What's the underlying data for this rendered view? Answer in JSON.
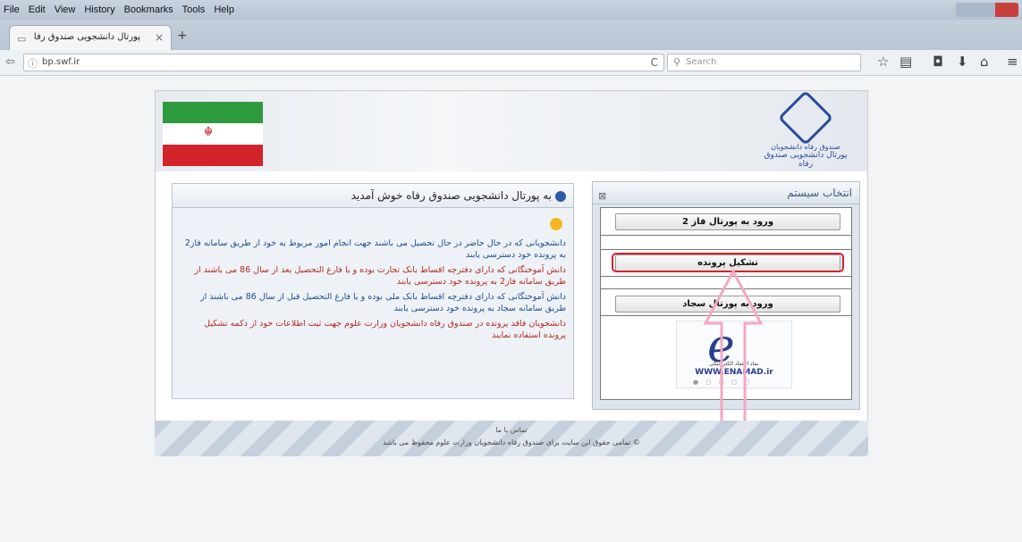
{
  "menu": [
    "File",
    "Edit",
    "View",
    "History",
    "Bookmarks",
    "Tools",
    "Help"
  ],
  "tab": {
    "title": "پورتال دانشجویی صندوق رفاه",
    "close": "×",
    "new": "+"
  },
  "nav": {
    "url": "bp.swf.ir",
    "search_placeholder": "Search",
    "reload": "C"
  },
  "toolbar_icons": [
    "star-icon",
    "library-icon",
    "pocket-icon",
    "download-icon",
    "home-icon",
    "menu-icon"
  ],
  "banner": {
    "logo_line1": "صندوق رفاه دانشجویان",
    "logo_line2": "پورتال دانشجویی صندوق رفاه"
  },
  "welcome": {
    "title": "به پورتال دانشجویی صندوق رفاه خوش آمدید",
    "paragraphs": [
      "دانشجویانی که در حال حاضر در حال تحصیل می باشند جهت انجام امور مربوط به خود از طریق سامانه فاز2 به پرونده خود دسترسی یابند",
      "دانش آموختگانی که دارای دفترچه اقساط بانک تجارت بوده و یا فارغ التحصیل بعد از سال 86 می باشند از طریق سامانه فاز2 به پرونده خود دسترسی یابند",
      "دانش آموختگانی که دارای دفترچه اقساط بانک ملی بوده و یا فارغ التحصیل قبل از سال 86 می باشند از طریق سامانه سجاد به پرونده خود دسترسی یابند",
      "دانشجویان فاقد پرونده در صندوق رفاه دانشجویان وزارت علوم جهت ثبت اطلاعات خود از دکمه تشکیل پرونده استفاده نمایند"
    ]
  },
  "system": {
    "title": "انتخاب سیستم",
    "btn_phase2": "ورود به پورتال فاز 2",
    "btn_create": "تشکیل پرونده",
    "btn_sajjad": "ورود به پورتال سجاد",
    "enamad_fa": "نماد اعتماد الکترونیکی",
    "enamad_url": "WWW.ENAMAD.ir"
  },
  "footer": {
    "line1": "تماس با ما",
    "line2": "© تمامی حقوق این سایت برای صندوق رفاه دانشجویان وزارت علوم محفوظ می باشد"
  },
  "colors": {
    "highlight": "#d6232e",
    "arrow": "#f4a7c3",
    "blue_text": "#1d4f8e",
    "red_text": "#b32a22"
  }
}
